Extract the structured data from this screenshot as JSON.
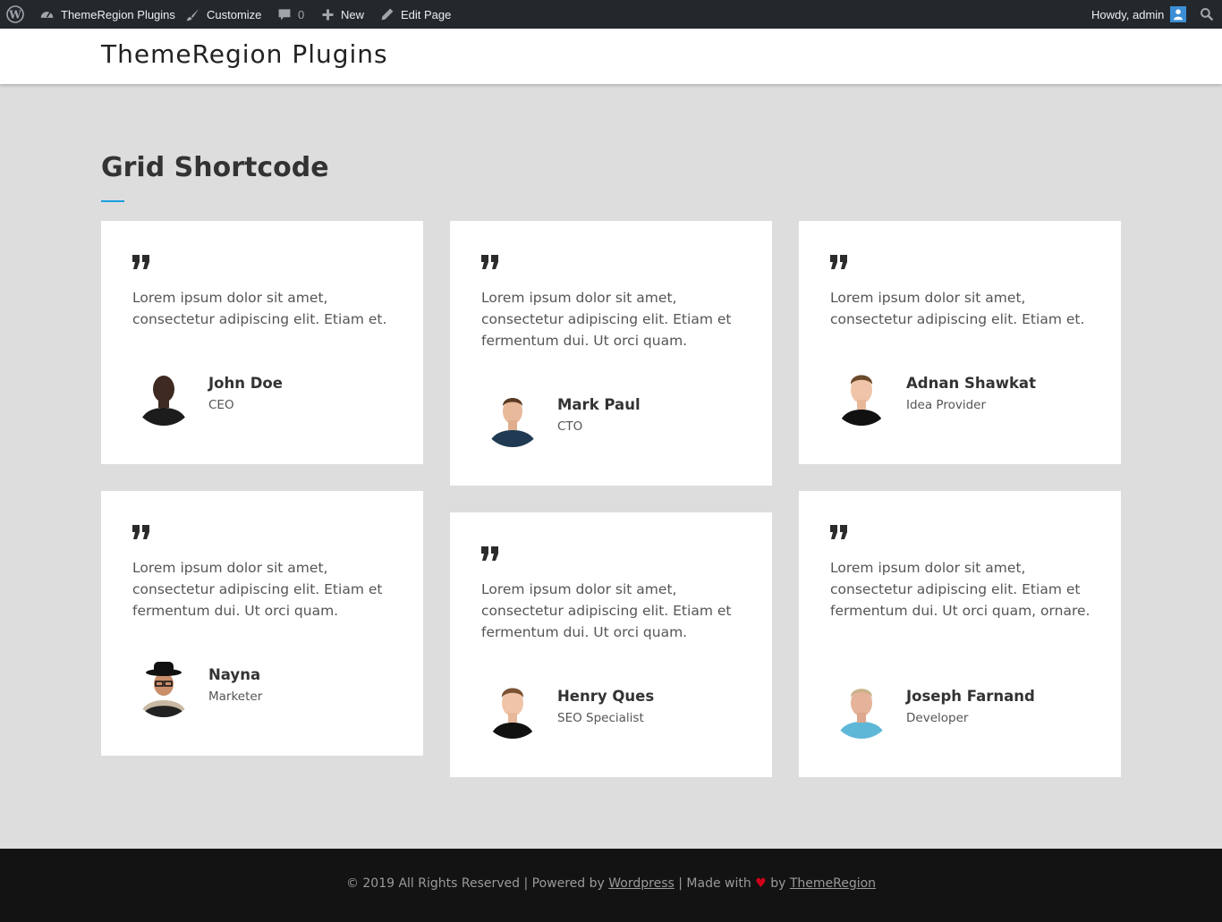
{
  "admin_bar": {
    "site_name": "ThemeRegion Plugins",
    "customize": "Customize",
    "comments_count": "0",
    "new": "New",
    "edit_page": "Edit Page",
    "howdy": "Howdy, admin",
    "icons": [
      "wordpress-icon",
      "dashboard-icon",
      "brush-icon",
      "comment-icon",
      "plus-icon",
      "pencil-icon",
      "user-avatar",
      "search-icon"
    ]
  },
  "header": {
    "site_title": "ThemeRegion Plugins"
  },
  "section": {
    "title": "Grid Shortcode",
    "accent_color": "#1aa0e0"
  },
  "testimonials": [
    {
      "text": "Lorem ipsum dolor sit amet, consectetur adipiscing elit. Etiam et.",
      "name": "John Doe",
      "role": "CEO"
    },
    {
      "text": "Lorem ipsum dolor sit amet, consectetur adipiscing elit. Etiam et fermentum dui. Ut orci quam.",
      "name": "Mark Paul",
      "role": "CTO"
    },
    {
      "text": "Lorem ipsum dolor sit amet, consectetur adipiscing elit. Etiam et.",
      "name": "Adnan Shawkat",
      "role": "Idea Provider"
    },
    {
      "text": "Lorem ipsum dolor sit amet, consectetur adipiscing elit. Etiam et fermentum dui. Ut orci quam.",
      "name": "Nayna",
      "role": "Marketer"
    },
    {
      "text": "Lorem ipsum dolor sit amet, consectetur adipiscing elit. Etiam et fermentum dui. Ut orci quam.",
      "name": "Henry Ques",
      "role": "SEO Specialist"
    },
    {
      "text": "Lorem ipsum dolor sit amet, consectetur adipiscing elit. Etiam et fermentum dui. Ut orci quam, ornare.",
      "name": "Joseph Farnand",
      "role": "Developer"
    }
  ],
  "footer": {
    "copyright": "© 2019 All Rights Reserved | Powered by",
    "wordpress_link": "Wordpress",
    "made_with": "| Made with",
    "heart": "♥",
    "by": "by",
    "themeregion_link": "ThemeRegion",
    "heart_color": "#d0021b"
  }
}
